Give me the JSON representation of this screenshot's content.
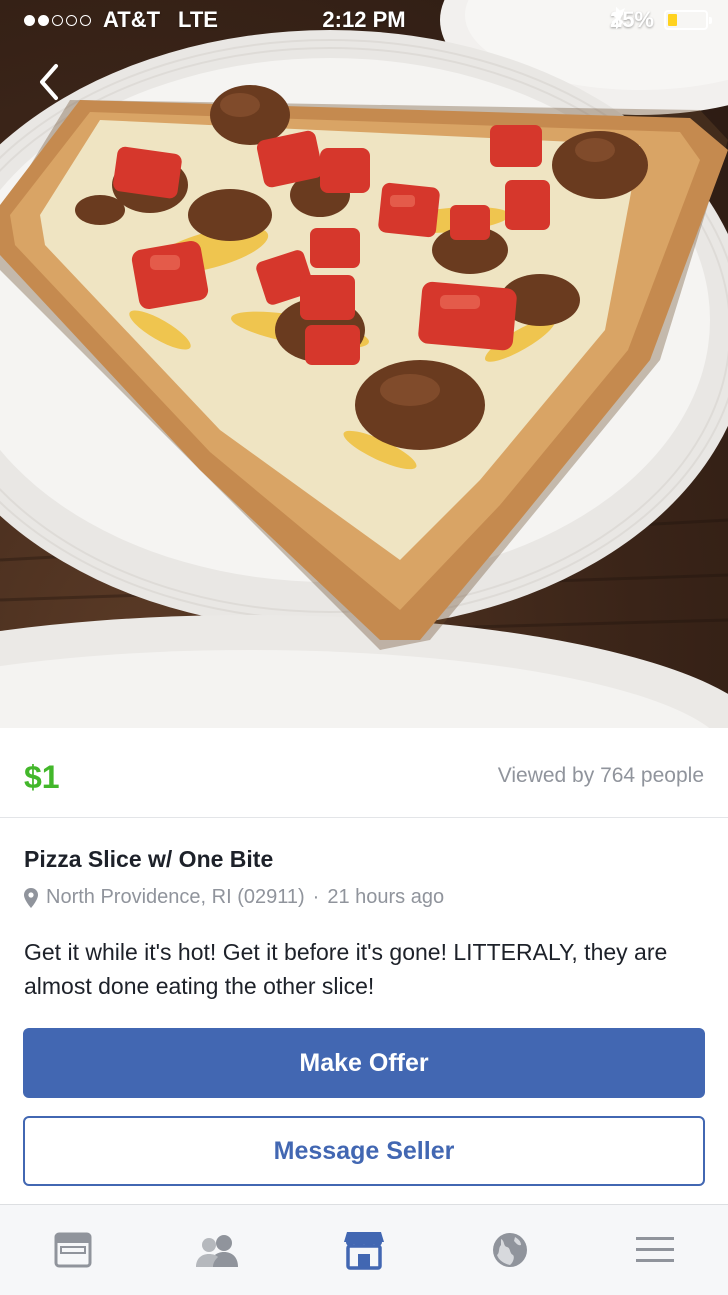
{
  "status_bar": {
    "carrier": "AT&T",
    "network": "LTE",
    "time": "2:12 PM",
    "battery": "25%",
    "battery_level": 0.25
  },
  "listing": {
    "price": "$1",
    "views": "Viewed by 764 people",
    "title": "Pizza Slice w/ One Bite",
    "location": "North Providence, RI (02911)",
    "separator": "·",
    "posted": "21 hours ago",
    "description": "Get it while it's hot! Get it before it's gone! LITTERALY, they are almost done eating the other slice!"
  },
  "actions": {
    "make_offer": "Make Offer",
    "message_seller": "Message Seller"
  },
  "tab_bar": {
    "tabs": [
      {
        "icon": "news-feed-icon",
        "active": false
      },
      {
        "icon": "friends-icon",
        "active": false
      },
      {
        "icon": "marketplace-icon",
        "active": true
      },
      {
        "icon": "globe-icon",
        "active": false
      },
      {
        "icon": "menu-icon",
        "active": false
      }
    ]
  },
  "colors": {
    "price": "#42b72a",
    "brand": "#4267b2",
    "secondary_text": "#90949c"
  }
}
